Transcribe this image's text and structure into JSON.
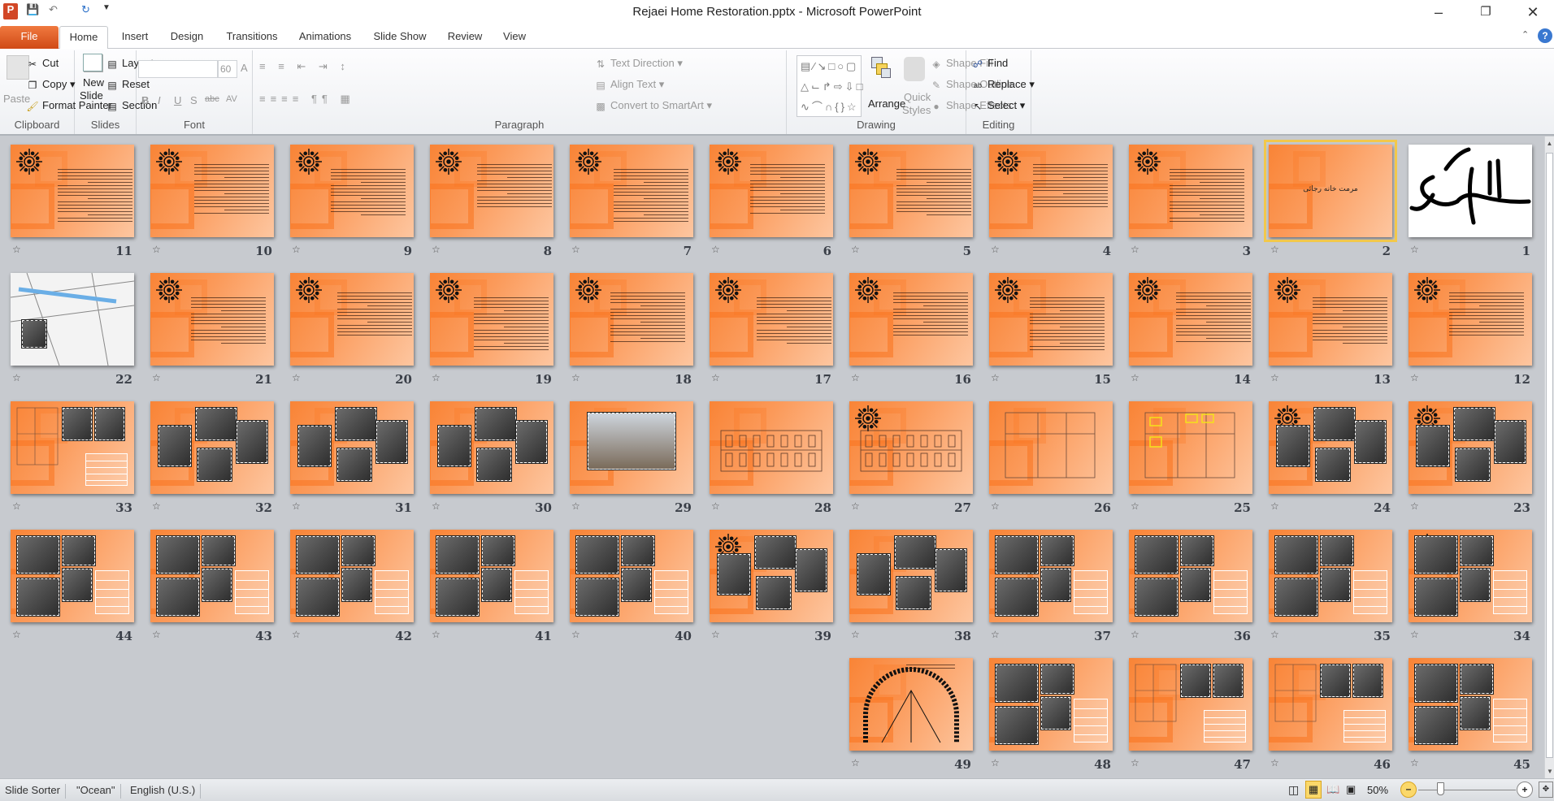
{
  "window": {
    "title": "Rejaei Home Restoration.pptx - Microsoft PowerPoint"
  },
  "tabs": [
    {
      "label": "File"
    },
    {
      "label": "Home"
    },
    {
      "label": "Insert"
    },
    {
      "label": "Design"
    },
    {
      "label": "Transitions"
    },
    {
      "label": "Animations"
    },
    {
      "label": "Slide Show"
    },
    {
      "label": "Review"
    },
    {
      "label": "View"
    }
  ],
  "ribbon": {
    "clipboard": {
      "label": "Clipboard",
      "paste": "Paste",
      "cut": "Cut",
      "copy": "Copy",
      "format_painter": "Format Painter"
    },
    "slides": {
      "label": "Slides",
      "new_slide_1": "New",
      "new_slide_2": "Slide",
      "layout": "Layout",
      "reset": "Reset",
      "section": "Section"
    },
    "font": {
      "label": "Font",
      "font_name": "",
      "font_size": "60"
    },
    "paragraph": {
      "label": "Paragraph",
      "text_direction": "Text Direction",
      "align_text": "Align Text",
      "convert_smartart": "Convert to SmartArt"
    },
    "drawing": {
      "label": "Drawing",
      "arrange": "Arrange",
      "quick_styles_1": "Quick",
      "quick_styles_2": "Styles",
      "shape_fill": "Shape Fill",
      "shape_outline": "Shape Outline",
      "shape_effects": "Shape Effects"
    },
    "editing": {
      "label": "Editing",
      "find": "Find",
      "replace": "Replace",
      "select": "Select"
    }
  },
  "slide2_title": "مرمت خانه رجائی",
  "selected_slide": 2,
  "slides": [
    {
      "n": 1,
      "kind": "calligraphy"
    },
    {
      "n": 2,
      "kind": "title"
    },
    {
      "n": 3,
      "kind": "text"
    },
    {
      "n": 4,
      "kind": "text"
    },
    {
      "n": 5,
      "kind": "text"
    },
    {
      "n": 6,
      "kind": "text"
    },
    {
      "n": 7,
      "kind": "text"
    },
    {
      "n": 8,
      "kind": "text"
    },
    {
      "n": 9,
      "kind": "text"
    },
    {
      "n": 10,
      "kind": "text"
    },
    {
      "n": 11,
      "kind": "text"
    },
    {
      "n": 12,
      "kind": "text"
    },
    {
      "n": 13,
      "kind": "text"
    },
    {
      "n": 14,
      "kind": "text"
    },
    {
      "n": 15,
      "kind": "text"
    },
    {
      "n": 16,
      "kind": "text"
    },
    {
      "n": 17,
      "kind": "text"
    },
    {
      "n": 18,
      "kind": "text"
    },
    {
      "n": 19,
      "kind": "text"
    },
    {
      "n": 20,
      "kind": "text"
    },
    {
      "n": 21,
      "kind": "text"
    },
    {
      "n": 22,
      "kind": "map"
    },
    {
      "n": 23,
      "kind": "photos"
    },
    {
      "n": 24,
      "kind": "photos"
    },
    {
      "n": 25,
      "kind": "plan"
    },
    {
      "n": 26,
      "kind": "plan"
    },
    {
      "n": 27,
      "kind": "elevation"
    },
    {
      "n": 28,
      "kind": "elevation"
    },
    {
      "n": 29,
      "kind": "photo"
    },
    {
      "n": 30,
      "kind": "photos"
    },
    {
      "n": 31,
      "kind": "photos"
    },
    {
      "n": 32,
      "kind": "photos"
    },
    {
      "n": 33,
      "kind": "plan-photos"
    },
    {
      "n": 34,
      "kind": "photos-table"
    },
    {
      "n": 35,
      "kind": "photos-table"
    },
    {
      "n": 36,
      "kind": "photos-table"
    },
    {
      "n": 37,
      "kind": "photos-table"
    },
    {
      "n": 38,
      "kind": "photos"
    },
    {
      "n": 39,
      "kind": "photos"
    },
    {
      "n": 40,
      "kind": "photos-table"
    },
    {
      "n": 41,
      "kind": "photos-table"
    },
    {
      "n": 42,
      "kind": "photos-table"
    },
    {
      "n": 43,
      "kind": "photos-table"
    },
    {
      "n": 44,
      "kind": "photos-table"
    },
    {
      "n": 45,
      "kind": "photos-table"
    },
    {
      "n": 46,
      "kind": "plan-photos"
    },
    {
      "n": 47,
      "kind": "plan-photos"
    },
    {
      "n": 48,
      "kind": "photos-table"
    },
    {
      "n": 49,
      "kind": "arch"
    }
  ],
  "status": {
    "view": "Slide Sorter",
    "theme": "\"Ocean\"",
    "language": "English (U.S.)",
    "zoom": "50%",
    "zoom_percent": 50
  },
  "colors": {
    "file_tab": "#d9541e",
    "selection": "#f2c84b",
    "slide_orange": "#f98436"
  }
}
